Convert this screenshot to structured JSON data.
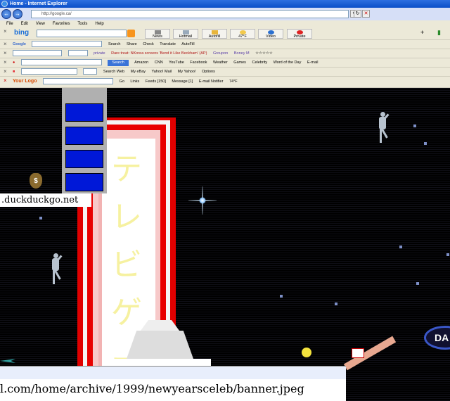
{
  "window": {
    "title": "Home - Internet Explorer"
  },
  "address": {
    "url": "http://google.ca/"
  },
  "menu": [
    "File",
    "Edit",
    "View",
    "Favorites",
    "Tools",
    "Help"
  ],
  "bing_toolbar": {
    "logo": "bing",
    "buttons": [
      "News",
      "Hotmail",
      "Autofill",
      "47°F",
      "Video",
      "Private"
    ]
  },
  "google_toolbar": {
    "logo": "Google",
    "items": [
      "Search",
      "Share",
      "Check",
      "Translate",
      "AutoFill"
    ]
  },
  "toolbar3": {
    "items": [
      "private",
      "Rare treat: NKorea screens 'Bend it Like Beckham' (AP)",
      "Groupon",
      "Boney M"
    ]
  },
  "ask_toolbar": {
    "search_button": "Search",
    "items": [
      "Amazon",
      "CNN",
      "YouTube",
      "Facebook",
      "Weather",
      "Games",
      "Celebrity",
      "Word of the Day",
      "E-mail"
    ]
  },
  "ebay_toolbar": {
    "items": [
      "Search Web",
      "My eBay",
      "Yahoo! Mail",
      "My Yahoo!",
      "Options"
    ]
  },
  "logo_toolbar": {
    "logo": "Your Logo",
    "items": [
      "Go",
      "Links",
      "Feeds [150]",
      "Message [1]",
      "E-mail Notifier",
      "74°F"
    ]
  },
  "page": {
    "url_label": ".duckduckgo.net",
    "katakana": "テレビゲー",
    "status_url": "l.com/home/archive/1999/newyearsceleb/banner.jpeg",
    "logo_text": "DA"
  }
}
